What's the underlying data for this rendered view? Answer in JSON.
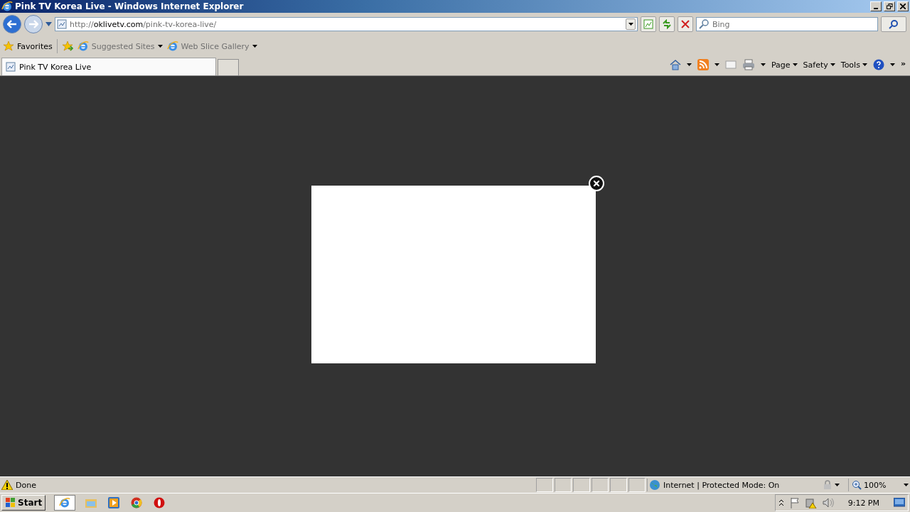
{
  "window": {
    "title": "Pink TV Korea Live - Windows Internet Explorer"
  },
  "address_bar": {
    "url_scheme": "http://",
    "url_domain": "oklivetv.com",
    "url_path": "/pink-tv-korea-live/"
  },
  "search": {
    "placeholder": "Bing"
  },
  "favorites_bar": {
    "favorites_label": "Favorites",
    "links": [
      {
        "label": "Suggested Sites"
      },
      {
        "label": "Web Slice Gallery"
      }
    ]
  },
  "tabs": [
    {
      "label": "Pink TV Korea Live",
      "selected": true
    }
  ],
  "command_bar": {
    "menus": [
      "Page",
      "Safety",
      "Tools"
    ],
    "overflow": "»"
  },
  "status_bar": {
    "text": "Done",
    "zone": "Internet | Protected Mode: On",
    "zoom": "100%"
  },
  "taskbar": {
    "start": "Start",
    "clock": "9:12 PM"
  }
}
